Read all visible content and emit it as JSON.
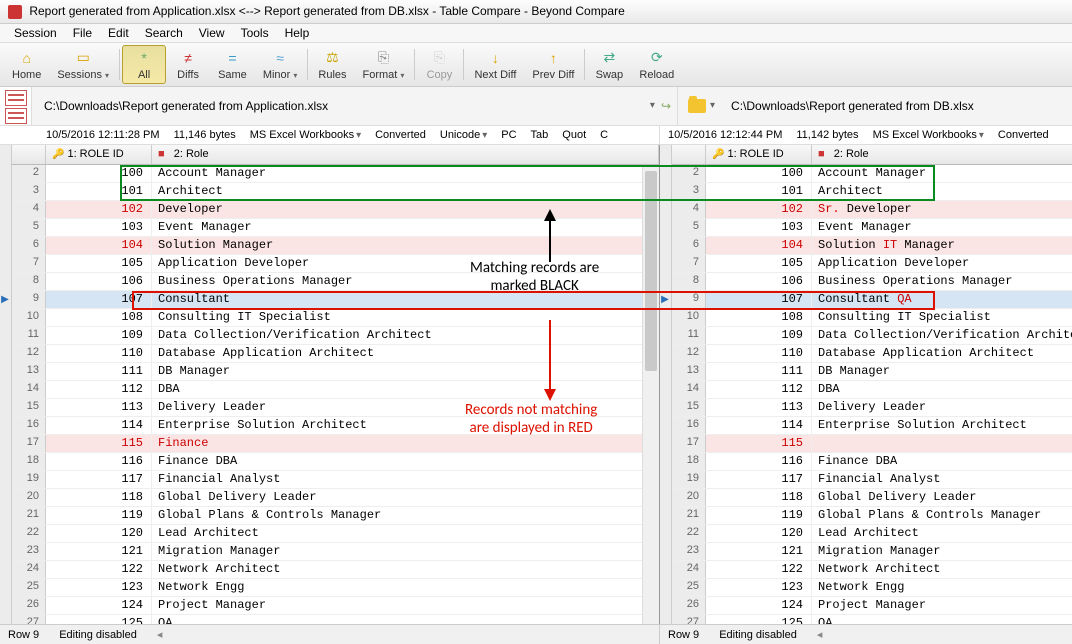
{
  "title": "Report generated from Application.xlsx <--> Report generated from DB.xlsx - Table Compare - Beyond Compare",
  "menu": [
    "Session",
    "File",
    "Edit",
    "Search",
    "View",
    "Tools",
    "Help"
  ],
  "toolbar": [
    {
      "label": "Home",
      "icon": "⌂",
      "color": "#d9a400"
    },
    {
      "label": "Sessions",
      "icon": "▭",
      "color": "#d9a400",
      "dd": true
    },
    {
      "label": "All",
      "icon": "*",
      "color": "#6a6",
      "pressed": true
    },
    {
      "label": "Diffs",
      "icon": "≠",
      "color": "#c33"
    },
    {
      "label": "Same",
      "icon": "=",
      "color": "#39c"
    },
    {
      "label": "Minor",
      "icon": "≈",
      "color": "#5aa4d4",
      "dd": true
    },
    {
      "label": "Rules",
      "icon": "⚖",
      "color": "#c9a400"
    },
    {
      "label": "Format",
      "icon": "⎘",
      "color": "#888",
      "dd": true
    },
    {
      "label": "Copy",
      "icon": "⎘",
      "color": "#aaa",
      "disabled": true
    },
    {
      "label": "Next Diff",
      "icon": "↓",
      "color": "#d9a400"
    },
    {
      "label": "Prev Diff",
      "icon": "↑",
      "color": "#d9a400"
    },
    {
      "label": "Swap",
      "icon": "⇄",
      "color": "#4a8"
    },
    {
      "label": "Reload",
      "icon": "⟳",
      "color": "#4a8"
    }
  ],
  "files": {
    "left": "C:\\Downloads\\Report generated from Application.xlsx",
    "right": "C:\\Downloads\\Report generated from DB.xlsx"
  },
  "info": {
    "left": {
      "date": "10/5/2016 12:11:28 PM",
      "size": "11,146 bytes",
      "type": "MS Excel Workbooks",
      "conv": "Converted",
      "enc": "Unicode",
      "plat": "PC",
      "tab": "Tab",
      "quot": "Quot",
      "c": "C"
    },
    "right": {
      "date": "10/5/2016 12:12:44 PM",
      "size": "11,142 bytes",
      "type": "MS Excel Workbooks",
      "conv": "Converted"
    }
  },
  "headers": {
    "col1": "1: ROLE ID",
    "col2": "2: Role"
  },
  "left_rows": [
    {
      "n": 2,
      "id": "100",
      "role": "Account Manager"
    },
    {
      "n": 3,
      "id": "101",
      "role": "Architect"
    },
    {
      "n": 4,
      "id": "102",
      "role": "Developer",
      "pink": true,
      "rid": true
    },
    {
      "n": 5,
      "id": "103",
      "role": "Event Manager"
    },
    {
      "n": 6,
      "id": "104",
      "role": "Solution Manager",
      "pink": true,
      "rid": true
    },
    {
      "n": 7,
      "id": "105",
      "role": "Application Developer"
    },
    {
      "n": 8,
      "id": "106",
      "role": "Business Operations Manager"
    },
    {
      "n": 9,
      "id": "107",
      "role": "Consultant",
      "sel": true
    },
    {
      "n": 10,
      "id": "108",
      "role": "Consulting IT Specialist"
    },
    {
      "n": 11,
      "id": "109",
      "role": "Data Collection/Verification Architect"
    },
    {
      "n": 12,
      "id": "110",
      "role": "Database Application Architect"
    },
    {
      "n": 13,
      "id": "111",
      "role": "DB Manager"
    },
    {
      "n": 14,
      "id": "112",
      "role": "DBA"
    },
    {
      "n": 15,
      "id": "113",
      "role": "Delivery Leader"
    },
    {
      "n": 16,
      "id": "114",
      "role": "Enterprise Solution Architect"
    },
    {
      "n": 17,
      "id": "115",
      "role": "Finance",
      "pink": true,
      "rrole": true,
      "rid": true
    },
    {
      "n": 18,
      "id": "116",
      "role": "Finance DBA"
    },
    {
      "n": 19,
      "id": "117",
      "role": "Financial Analyst"
    },
    {
      "n": 20,
      "id": "118",
      "role": "Global Delivery Leader"
    },
    {
      "n": 21,
      "id": "119",
      "role": "Global Plans & Controls Manager"
    },
    {
      "n": 22,
      "id": "120",
      "role": "Lead Architect"
    },
    {
      "n": 23,
      "id": "121",
      "role": "Migration Manager"
    },
    {
      "n": 24,
      "id": "122",
      "role": "Network Architect"
    },
    {
      "n": 25,
      "id": "123",
      "role": "Network Engg"
    },
    {
      "n": 26,
      "id": "124",
      "role": "Project Manager"
    },
    {
      "n": 27,
      "id": "125",
      "role": "QA"
    }
  ],
  "right_rows": [
    {
      "n": 2,
      "id": "100",
      "role": "Account Manager"
    },
    {
      "n": 3,
      "id": "101",
      "role": "Architect"
    },
    {
      "n": 4,
      "id": "102",
      "role_html": "<span class='red'>Sr.</span> Developer",
      "pink": true,
      "rid": true
    },
    {
      "n": 5,
      "id": "103",
      "role": "Event Manager"
    },
    {
      "n": 6,
      "id": "104",
      "role_html": "Solution <span class='red'>IT</span> Manager",
      "pink": true,
      "rid": true
    },
    {
      "n": 7,
      "id": "105",
      "role": "Application Developer"
    },
    {
      "n": 8,
      "id": "106",
      "role": "Business Operations Manager"
    },
    {
      "n": 9,
      "id": "107",
      "role_html": "Consultant <span class='red'>QA</span>",
      "sel": true
    },
    {
      "n": 10,
      "id": "108",
      "role": "Consulting IT Specialist"
    },
    {
      "n": 11,
      "id": "109",
      "role": "Data Collection/Verification Architect"
    },
    {
      "n": 12,
      "id": "110",
      "role": "Database Application Architect"
    },
    {
      "n": 13,
      "id": "111",
      "role": "DB Manager"
    },
    {
      "n": 14,
      "id": "112",
      "role": "DBA"
    },
    {
      "n": 15,
      "id": "113",
      "role": "Delivery Leader"
    },
    {
      "n": 16,
      "id": "114",
      "role": "Enterprise Solution Architect"
    },
    {
      "n": 17,
      "id": "115",
      "role": "",
      "pink": true,
      "rid": true
    },
    {
      "n": 18,
      "id": "116",
      "role": "Finance DBA"
    },
    {
      "n": 19,
      "id": "117",
      "role": "Financial Analyst"
    },
    {
      "n": 20,
      "id": "118",
      "role": "Global Delivery Leader"
    },
    {
      "n": 21,
      "id": "119",
      "role": "Global Plans & Controls Manager"
    },
    {
      "n": 22,
      "id": "120",
      "role": "Lead Architect"
    },
    {
      "n": 23,
      "id": "121",
      "role": "Migration Manager"
    },
    {
      "n": 24,
      "id": "122",
      "role": "Network Architect"
    },
    {
      "n": 25,
      "id": "123",
      "role": "Network Engg"
    },
    {
      "n": 26,
      "id": "124",
      "role": "Project Manager"
    },
    {
      "n": 27,
      "id": "125",
      "role": "QA"
    }
  ],
  "annotations": {
    "match": "Matching records are\nmarked BLACK",
    "nomatch": "Records not matching\nare displayed in RED"
  },
  "status": {
    "row": "Row 9",
    "edit": "Editing disabled"
  }
}
